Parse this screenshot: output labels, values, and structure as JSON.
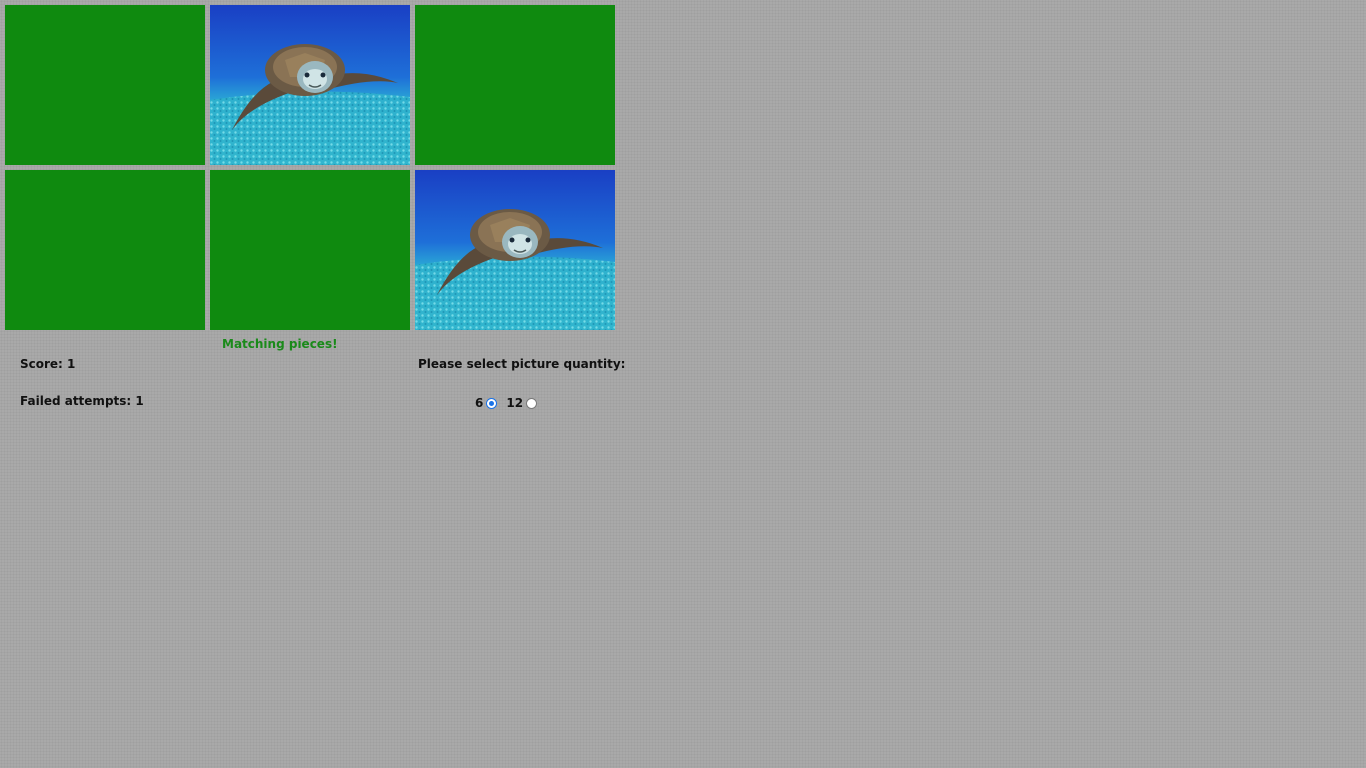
{
  "board": {
    "cards": [
      {
        "state": "hidden"
      },
      {
        "state": "revealed",
        "image": "sea-turtle"
      },
      {
        "state": "hidden"
      },
      {
        "state": "hidden"
      },
      {
        "state": "hidden"
      },
      {
        "state": "revealed",
        "image": "sea-turtle"
      }
    ],
    "card_back_color": "#0f8a0f"
  },
  "status": {
    "message": "Matching pieces!",
    "message_color": "#1a8a1a"
  },
  "stats": {
    "score": "Score: 1",
    "failed": "Failed attempts: 1"
  },
  "quantity": {
    "prompt": "Please select picture quantity:",
    "options": [
      {
        "label": "6",
        "checked": true
      },
      {
        "label": "12",
        "checked": false
      }
    ]
  }
}
